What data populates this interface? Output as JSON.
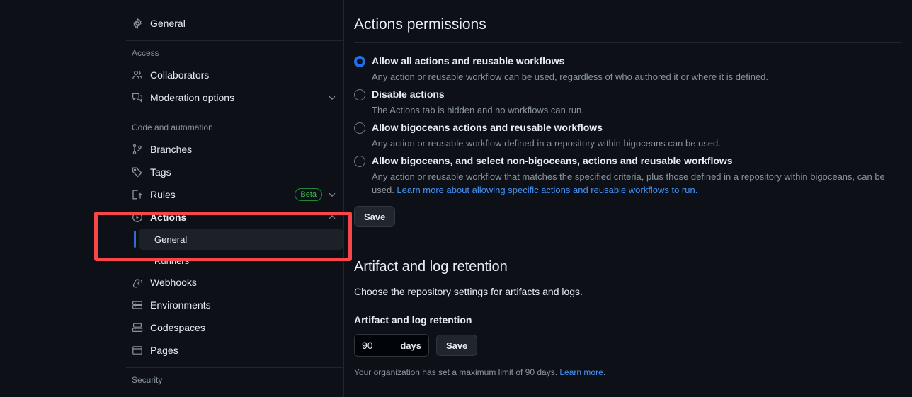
{
  "sidebar": {
    "top_items": [
      {
        "label": "General",
        "icon": "gear-icon",
        "name": "general"
      }
    ],
    "sections": [
      {
        "title": "Access",
        "items": [
          {
            "label": "Collaborators",
            "icon": "people-icon",
            "name": "collaborators",
            "expandable": false
          },
          {
            "label": "Moderation options",
            "icon": "comment-discussion-icon",
            "name": "moderation-options",
            "expandable": true,
            "chevron": "chevron-down-icon"
          }
        ]
      },
      {
        "title": "Code and automation",
        "items": [
          {
            "label": "Branches",
            "icon": "git-branch-icon",
            "name": "branches",
            "expandable": false
          },
          {
            "label": "Tags",
            "icon": "tag-icon",
            "name": "tags",
            "expandable": false
          },
          {
            "label": "Rules",
            "icon": "rules-icon",
            "name": "rules",
            "expandable": true,
            "badge": "Beta",
            "chevron": "chevron-down-icon"
          },
          {
            "label": "Actions",
            "icon": "play-icon",
            "name": "actions",
            "expandable": true,
            "expanded": true,
            "chevron": "chevron-up-icon",
            "bold": true
          },
          {
            "label": "Webhooks",
            "icon": "webhook-icon",
            "name": "webhooks",
            "expandable": false
          },
          {
            "label": "Environments",
            "icon": "server-icon",
            "name": "environments",
            "expandable": false
          },
          {
            "label": "Codespaces",
            "icon": "codespaces-icon",
            "name": "codespaces",
            "expandable": false
          },
          {
            "label": "Pages",
            "icon": "browser-icon",
            "name": "pages",
            "expandable": false
          }
        ]
      },
      {
        "title": "Security",
        "items": []
      }
    ],
    "actions_subitems": [
      {
        "label": "General",
        "name": "actions-general",
        "selected": true
      },
      {
        "label": "Runners",
        "name": "actions-runners",
        "selected": false
      }
    ]
  },
  "main": {
    "heading": "Actions permissions",
    "options": [
      {
        "title": "Allow all actions and reusable workflows",
        "desc": "Any action or reusable workflow can be used, regardless of who authored it or where it is defined.",
        "checked": true,
        "name": "allow-all-actions"
      },
      {
        "title": "Disable actions",
        "desc": "The Actions tab is hidden and no workflows can run.",
        "checked": false,
        "name": "disable-actions"
      },
      {
        "title": "Allow bigoceans actions and reusable workflows",
        "desc": "Any action or reusable workflow defined in a repository within bigoceans can be used.",
        "checked": false,
        "name": "allow-bigoceans-actions"
      },
      {
        "title": "Allow bigoceans, and select non-bigoceans, actions and reusable workflows",
        "desc": "Any action or reusable workflow that matches the specified criteria, plus those defined in a repository within bigoceans, can be used. ",
        "desc_link": "Learn more about allowing specific actions and reusable workflows to run.",
        "checked": false,
        "name": "allow-bigoceans-and-select-non-bigoceans"
      }
    ],
    "permissions_save_label": "Save",
    "retention": {
      "heading": "Artifact and log retention",
      "subtitle": "Choose the repository settings for artifacts and logs.",
      "field_label": "Artifact and log retention",
      "value": "90",
      "unit": "days",
      "save_label": "Save",
      "note_text": "Your organization has set a maximum limit of 90 days. ",
      "note_link": "Learn more",
      "note_suffix": "."
    }
  },
  "annotation": {
    "highlight_color": "#fa4549",
    "target": "actions-general-nav"
  }
}
